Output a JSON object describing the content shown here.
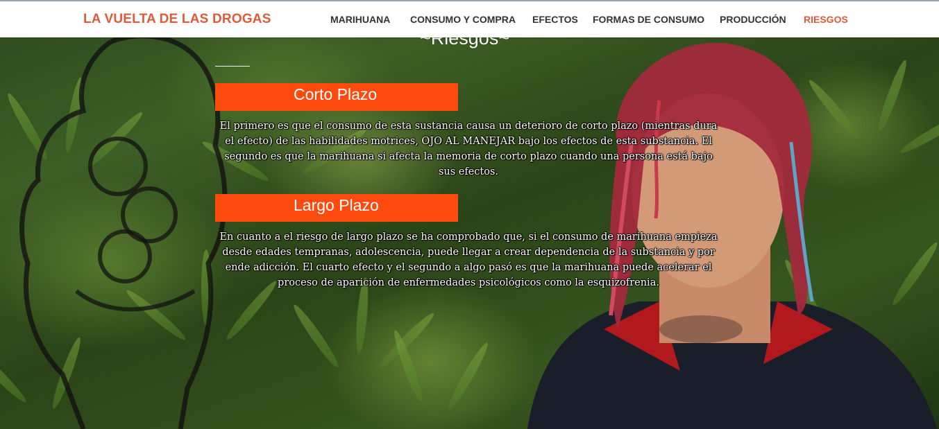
{
  "header": {
    "brand": "LA VUELTA DE LAS DROGAS",
    "nav": [
      {
        "label": "MARIHUANA",
        "active": false
      },
      {
        "label": "CONSUMO Y COMPRA",
        "active": false
      },
      {
        "label": "EFECTOS",
        "active": false
      },
      {
        "label": "FORMAS DE CONSUMO",
        "active": false
      },
      {
        "label": "PRODUCCIÓN",
        "active": false
      },
      {
        "label": "RIESGOS",
        "active": true
      }
    ]
  },
  "main": {
    "section_title": "~Riesgos~",
    "short_term": {
      "heading": "Corto Plazo",
      "text": "El primero es que el consumo de esta sustancia causa un deterioro de corto plazo (mientras dura el efecto) de las habilidades motrices, OJO AL MANEJAR bajo los efectos de esta substancia. El segundo es que la marihuana si afecta la memoria de corto plazo cuando una persona está bajo sus efectos."
    },
    "long_term": {
      "heading": "Largo Plazo",
      "text": "En cuanto a el riesgo de largo plazo se ha comprobado que, si el consumo de marihuana empieza desde edades tempranas, adolescencia, puede llegar a crear dependencia de la substancia y por ende adicción. El cuarto efecto y el segundo a algo pasó es que la marihuana puede acelerar el proceso de aparición de enfermedades psicológicos como la esquizofrenia."
    }
  },
  "colors": {
    "accent": "#e05a3a",
    "heading_bg": "#fd4a0e",
    "nav_text": "#333333"
  }
}
